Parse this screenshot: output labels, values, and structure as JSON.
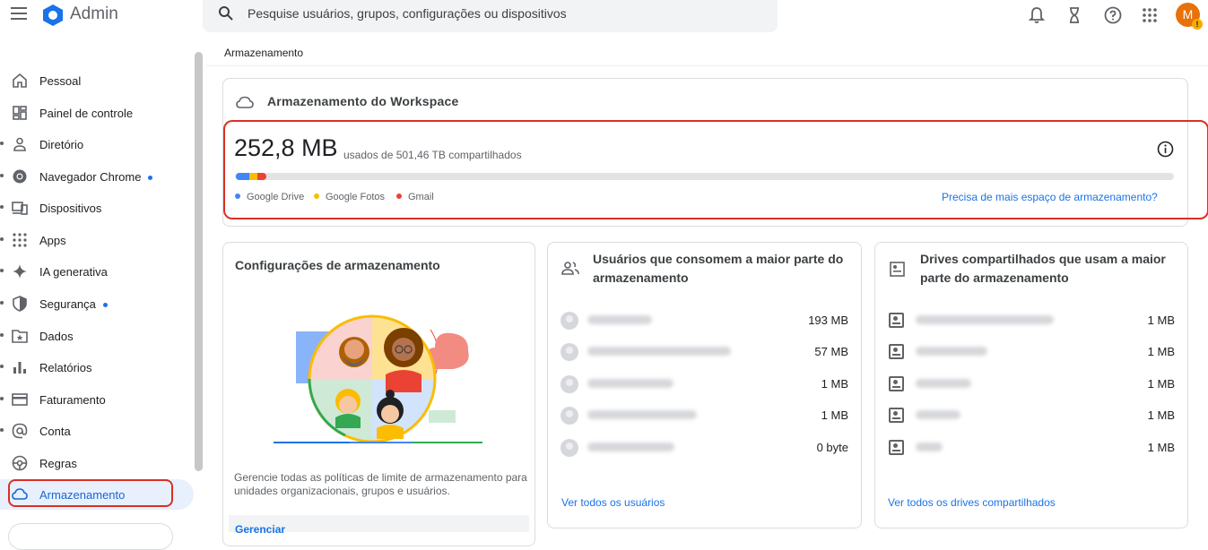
{
  "header": {
    "app_name": "Admin",
    "search_placeholder": "Pesquise usuários, grupos, configurações ou dispositivos",
    "avatar_letter": "M",
    "avatar_warning": "!",
    "icons": [
      "notifications-icon",
      "tasks-hourglass-icon",
      "help-icon",
      "apps-grid-icon"
    ]
  },
  "sidebar": {
    "items": [
      {
        "label": "Pessoal",
        "icon": "home-icon",
        "expandable": false,
        "dot": false
      },
      {
        "label": "Painel de controle",
        "icon": "dashboard-icon",
        "expandable": false,
        "dot": false
      },
      {
        "label": "Diretório",
        "icon": "person-icon",
        "expandable": true,
        "dot": false
      },
      {
        "label": "Navegador Chrome",
        "icon": "chrome-icon",
        "expandable": true,
        "dot": true
      },
      {
        "label": "Dispositivos",
        "icon": "devices-icon",
        "expandable": true,
        "dot": false
      },
      {
        "label": "Apps",
        "icon": "apps-icon",
        "expandable": true,
        "dot": false
      },
      {
        "label": "IA generativa",
        "icon": "sparkle-icon",
        "expandable": true,
        "dot": false
      },
      {
        "label": "Segurança",
        "icon": "shield-icon",
        "expandable": true,
        "dot": true
      },
      {
        "label": "Dados",
        "icon": "data-folder-icon",
        "expandable": true,
        "dot": false
      },
      {
        "label": "Relatórios",
        "icon": "bar-chart-icon",
        "expandable": true,
        "dot": false
      },
      {
        "label": "Faturamento",
        "icon": "credit-card-icon",
        "expandable": true,
        "dot": false
      },
      {
        "label": "Conta",
        "icon": "at-sign-icon",
        "expandable": true,
        "dot": false
      },
      {
        "label": "Regras",
        "icon": "rules-icon",
        "expandable": false,
        "dot": false
      },
      {
        "label": "Armazenamento",
        "icon": "cloud-icon",
        "expandable": false,
        "dot": false,
        "active": true
      }
    ]
  },
  "breadcrumb": "Armazenamento",
  "workspace": {
    "title": "Armazenamento do Workspace",
    "used": "252,8 MB",
    "used_suffix": "usados de 501,46 TB compartilhados",
    "legend": [
      {
        "label": "Google Drive",
        "color": "#4285f4"
      },
      {
        "label": "Google Fotos",
        "color": "#fbbc04"
      },
      {
        "label": "Gmail",
        "color": "#ea4335"
      }
    ],
    "more_link": "Precisa de mais espaço de armazenamento?"
  },
  "settings_card": {
    "title": "Configurações de armazenamento",
    "description": "Gerencie todas as políticas de limite de armazenamento para unidades organizacionais, grupos e usuários.",
    "manage_label": "Gerenciar"
  },
  "users_card": {
    "title": "Usuários que consomem a maior parte do armazenamento",
    "rows": [
      {
        "name": "Renan Reis",
        "value": "193 MB"
      },
      {
        "name": "Treinamento TI Class Cloud",
        "value": "57 MB"
      },
      {
        "name": "Mateus Santana",
        "value": "1 MB"
      },
      {
        "name": "Guilherme Bortolotto",
        "value": "1 MB"
      },
      {
        "name": "Eduardo Mendes",
        "value": "0 byte"
      }
    ],
    "link": "Ver todos os usuários"
  },
  "drives_card": {
    "title": "Drives compartilhados que usam a maior parte do armazenamento",
    "rows": [
      {
        "name": "Compartilhamento externo",
        "value": "1 MB"
      },
      {
        "name": "Teste Victoria",
        "value": "1 MB"
      },
      {
        "name": "Teste Jean",
        "value": "1 MB"
      },
      {
        "name": "Teste ux",
        "value": "1 MB"
      },
      {
        "name": "teste",
        "value": "1 MB"
      }
    ],
    "link": "Ver todos os drives compartilhados"
  }
}
